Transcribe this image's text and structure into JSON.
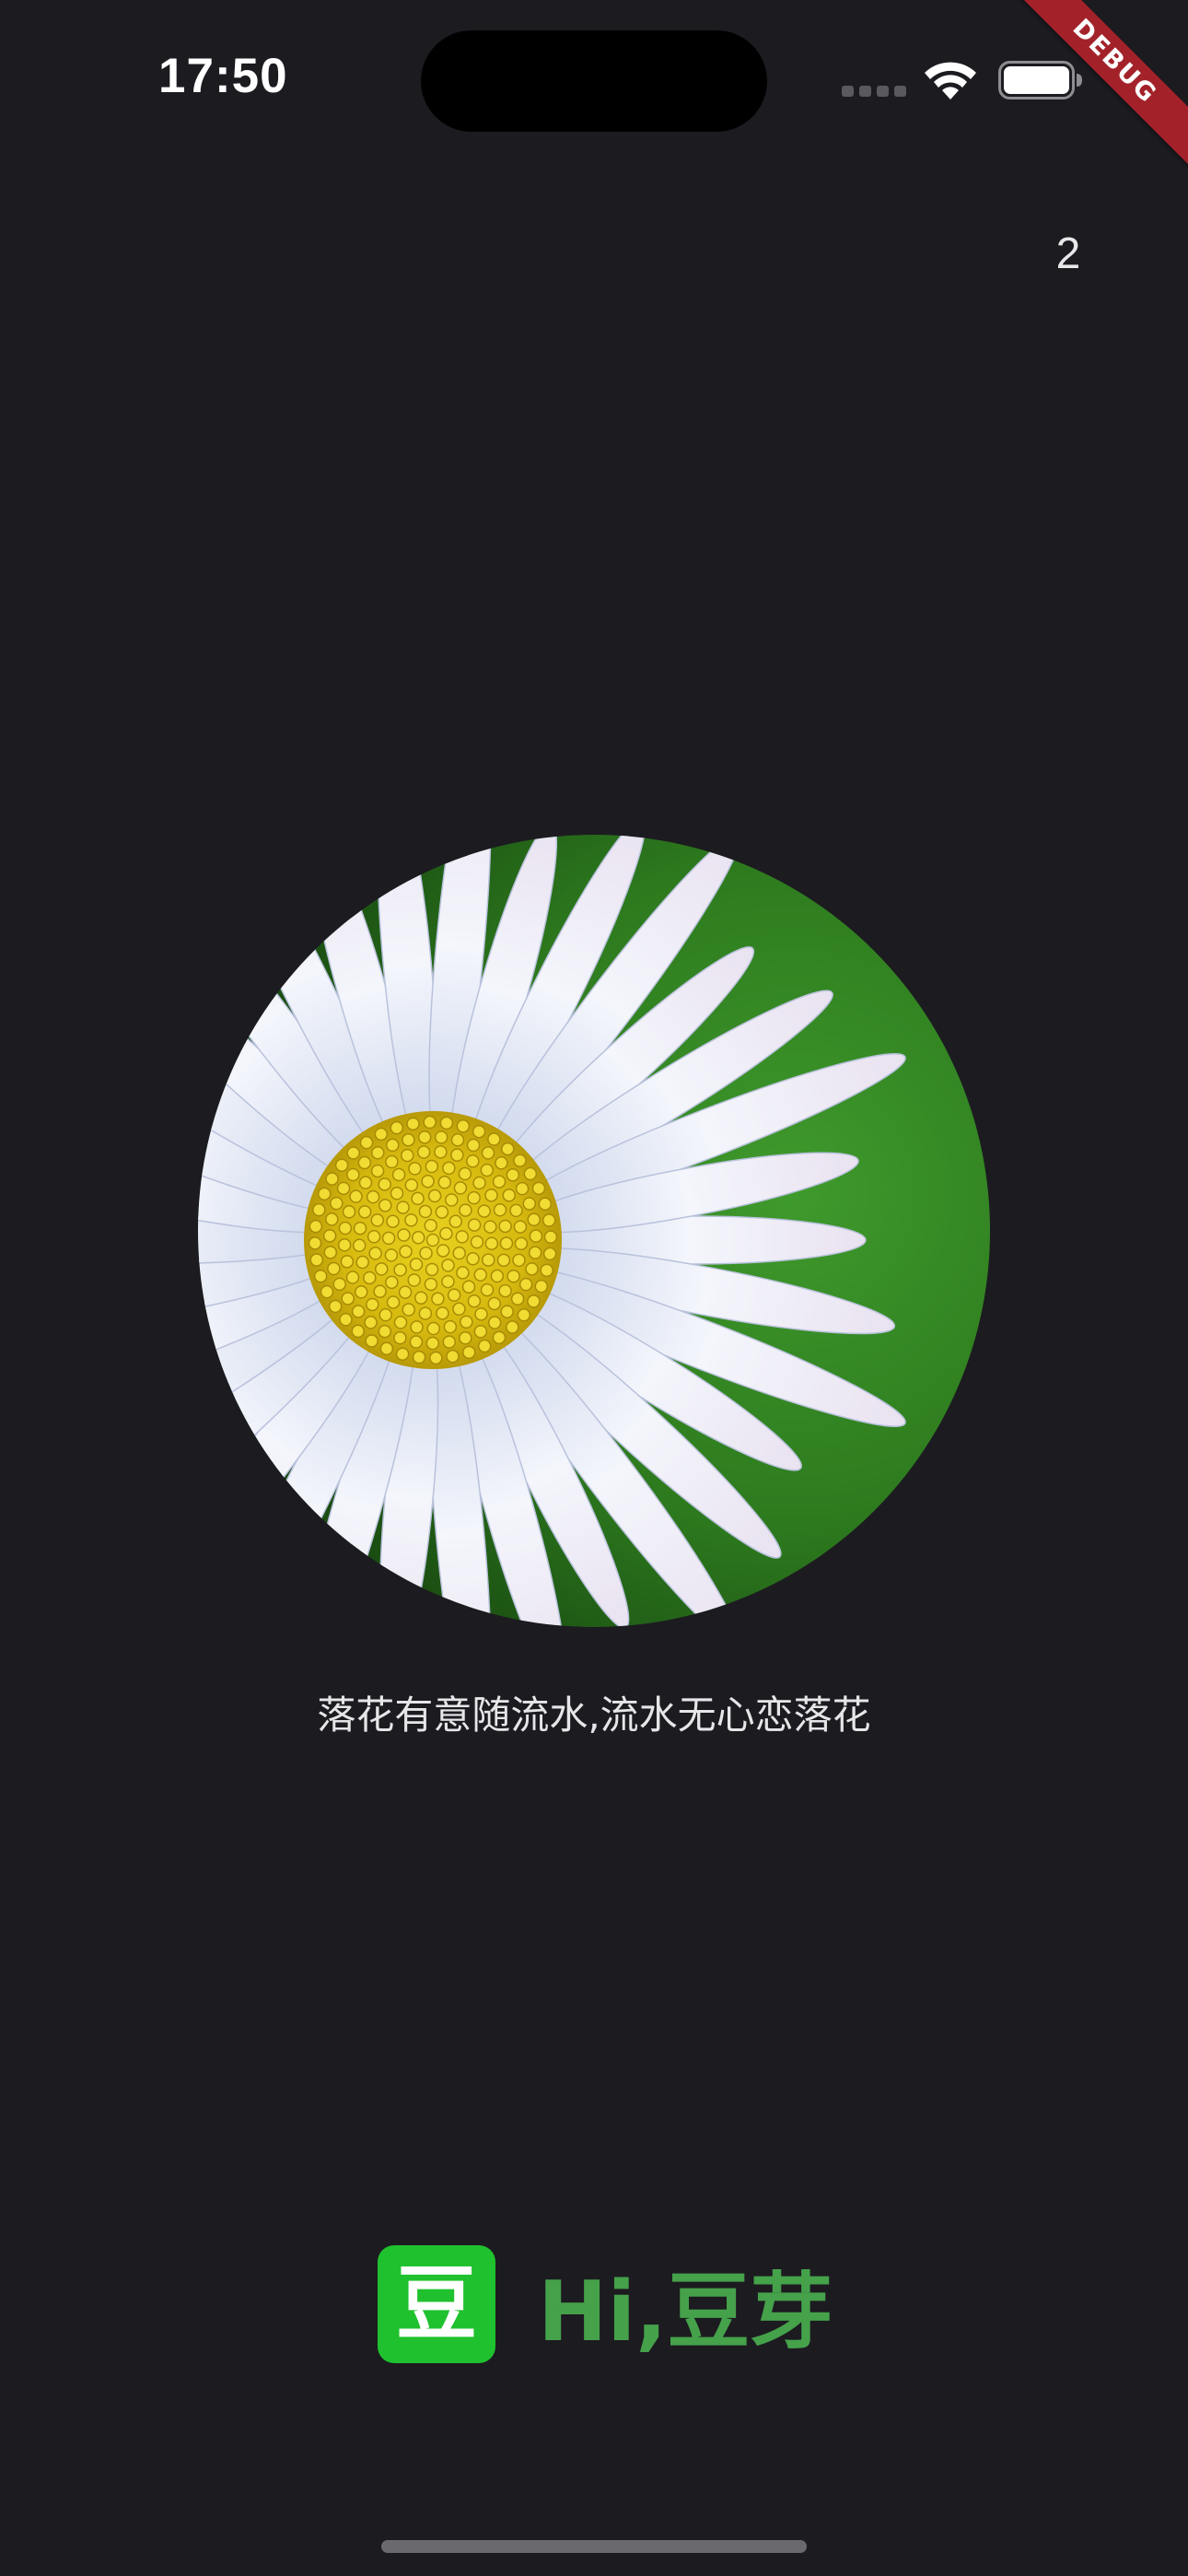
{
  "status_bar": {
    "time": "17:50"
  },
  "debug_banner": "DEBUG",
  "page_counter": "2",
  "image": {
    "icon": "daisy-flower-photo"
  },
  "caption": "落花有意随流水,流水无心恋落花",
  "brand": {
    "logo_char": "豆",
    "text": "Hi,豆芽",
    "logo_color": "#1fc12e",
    "text_color": "#45a14a"
  },
  "colors": {
    "background": "#1c1b20",
    "debug_banner": "#a3222a"
  }
}
